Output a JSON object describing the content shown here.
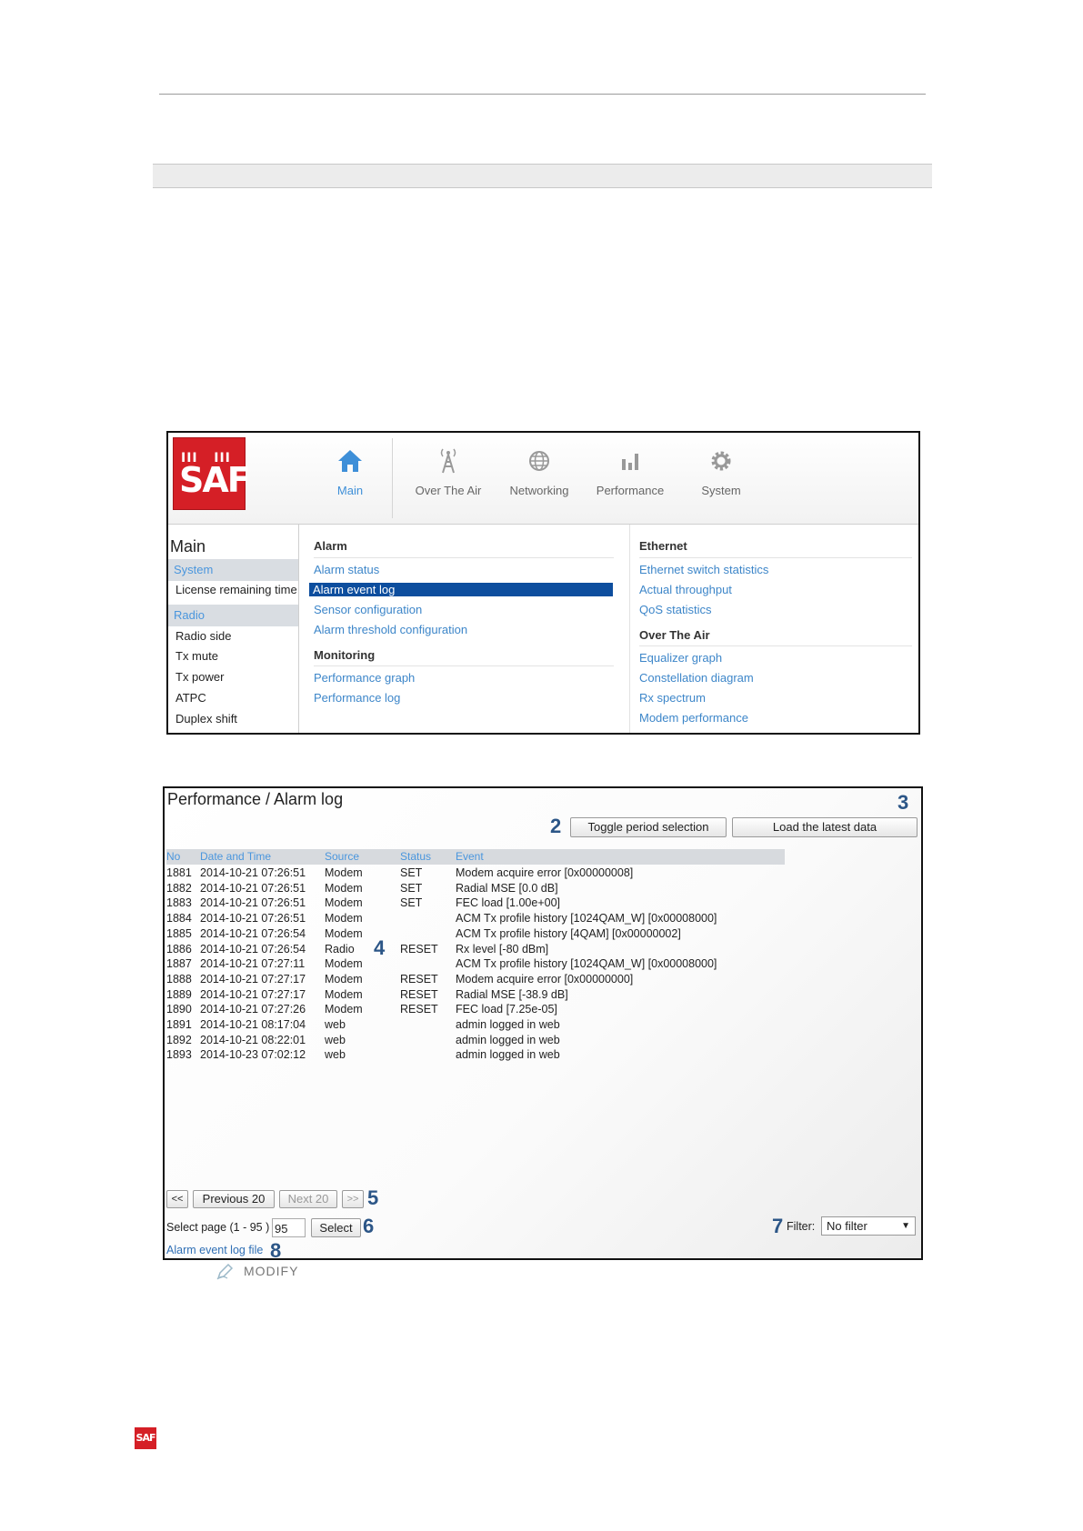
{
  "menu_shot": {
    "logo_text": "SAF",
    "nav": [
      {
        "label": "Main",
        "icon": "home-icon"
      },
      {
        "label": "Over The Air",
        "icon": "antenna-tower-icon"
      },
      {
        "label": "Networking",
        "icon": "globe-icon"
      },
      {
        "label": "Performance",
        "icon": "bar-chart-icon"
      },
      {
        "label": "System",
        "icon": "gear-icon"
      }
    ],
    "left": {
      "title": "Main",
      "system_section": "System",
      "system_items": [
        "License remaining time"
      ],
      "radio_section": "Radio",
      "radio_items": [
        "Radio side",
        "Tx mute",
        "Tx power",
        "ATPC",
        "Duplex shift"
      ]
    },
    "alarm": {
      "heading": "Alarm",
      "links": [
        "Alarm status",
        "Alarm event log",
        "Sensor configuration",
        "Alarm threshold configuration"
      ],
      "selected": "Alarm event log"
    },
    "monitoring": {
      "heading": "Monitoring",
      "links": [
        "Performance graph",
        "Performance log"
      ]
    },
    "ethernet": {
      "heading": "Ethernet",
      "links": [
        "Ethernet switch statistics",
        "Actual throughput",
        "QoS statistics"
      ]
    },
    "over_the_air": {
      "heading": "Over The Air",
      "links": [
        "Equalizer graph",
        "Constellation diagram",
        "Rx spectrum",
        "Modem performance"
      ]
    }
  },
  "log_shot": {
    "title": "Performance / Alarm log",
    "toggle_button": "Toggle period selection",
    "load_button": "Load the latest data",
    "columns": [
      "No",
      "Date and Time",
      "Source",
      "Status",
      "Event"
    ],
    "rows": [
      [
        "1881",
        "2014-10-21 07:26:51",
        "Modem",
        "SET",
        "Modem acquire error [0x00000008]"
      ],
      [
        "1882",
        "2014-10-21 07:26:51",
        "Modem",
        "SET",
        "Radial MSE [0.0 dB]"
      ],
      [
        "1883",
        "2014-10-21 07:26:51",
        "Modem",
        "SET",
        "FEC load [1.00e+00]"
      ],
      [
        "1884",
        "2014-10-21 07:26:51",
        "Modem",
        "",
        "ACM Tx profile history [1024QAM_W] [0x00008000]"
      ],
      [
        "1885",
        "2014-10-21 07:26:54",
        "Modem",
        "",
        "ACM Tx profile history [4QAM] [0x00000002]"
      ],
      [
        "1886",
        "2014-10-21 07:26:54",
        "Radio",
        "RESET",
        "Rx level [-80 dBm]"
      ],
      [
        "1887",
        "2014-10-21 07:27:11",
        "Modem",
        "",
        "ACM Tx profile history [1024QAM_W] [0x00008000]"
      ],
      [
        "1888",
        "2014-10-21 07:27:17",
        "Modem",
        "RESET",
        "Modem acquire error [0x00000000]"
      ],
      [
        "1889",
        "2014-10-21 07:27:17",
        "Modem",
        "RESET",
        "Radial MSE [-38.9 dB]"
      ],
      [
        "1890",
        "2014-10-21 07:27:26",
        "Modem",
        "RESET",
        "FEC load [7.25e-05]"
      ],
      [
        "1891",
        "2014-10-21 08:17:04",
        "web",
        "",
        "admin logged in web"
      ],
      [
        "1892",
        "2014-10-21 08:22:01",
        "web",
        "",
        "admin logged in web"
      ],
      [
        "1893",
        "2014-10-23 07:02:12",
        "web",
        "",
        "admin logged in web"
      ]
    ],
    "nav_first": "<<",
    "nav_prev": "Previous 20",
    "nav_next": "Next 20",
    "nav_last": ">>",
    "select_label": "Select page (1 - 95 )",
    "select_value": "95",
    "select_button": "Select",
    "filter_label": "Filter:",
    "filter_value": "No filter",
    "log_file_link": "Alarm event log file",
    "callouts": {
      "c2": "2",
      "c3": "3",
      "c4": "4",
      "c5": "5",
      "c6": "6",
      "c7": "7",
      "c8": "8"
    }
  },
  "modify_label": "MODIFY",
  "footer_logo": "SAF"
}
